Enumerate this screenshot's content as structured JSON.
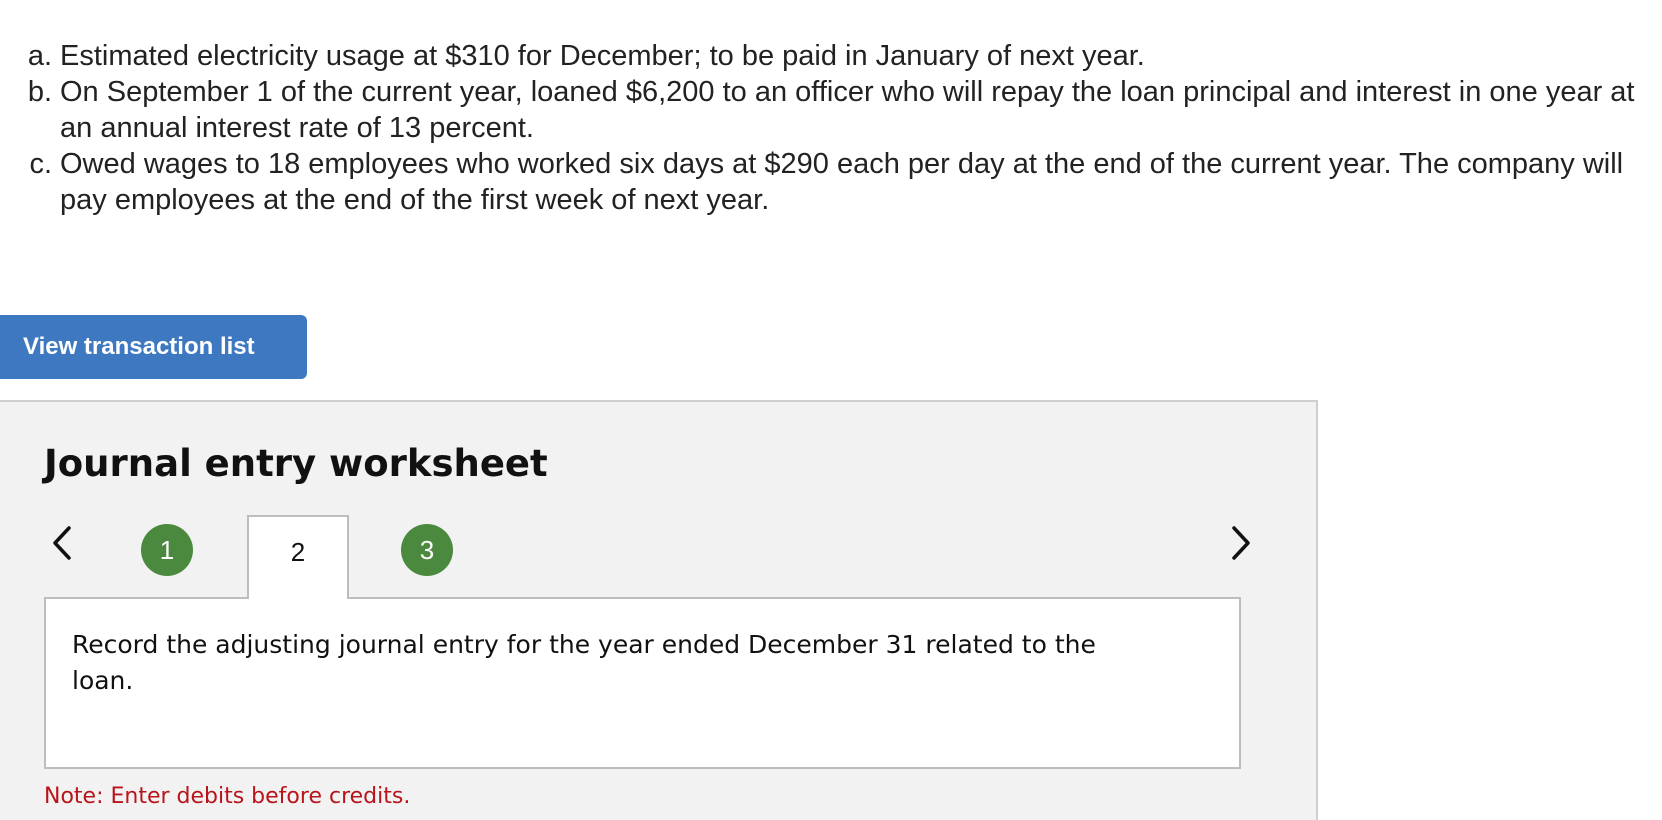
{
  "problem": {
    "items": [
      {
        "marker": "a.",
        "text": "Estimated electricity usage at $310 for December; to be paid in January of next year."
      },
      {
        "marker": "b.",
        "text": "On September 1 of the current year, loaned $6,200 to an officer who will repay the loan principal and interest in one year at an annual interest rate of 13 percent."
      },
      {
        "marker": "c.",
        "text": "Owed wages to 18 employees who worked six days at $290 each per day at the end of the current year. The company will pay employees at the end of the first week of next year."
      }
    ]
  },
  "toolbar": {
    "view_transactions_label": "View transaction list"
  },
  "worksheet": {
    "title": "Journal entry worksheet",
    "steps": [
      "1",
      "2",
      "3"
    ],
    "active_step": "2",
    "instruction": "Record the adjusting journal entry for the year ended December 31 related to the loan.",
    "note": "Note: Enter debits before credits.",
    "colors": {
      "step_complete": "#4b8a3e",
      "note": "#b8141b",
      "button": "#3d78c1"
    }
  }
}
